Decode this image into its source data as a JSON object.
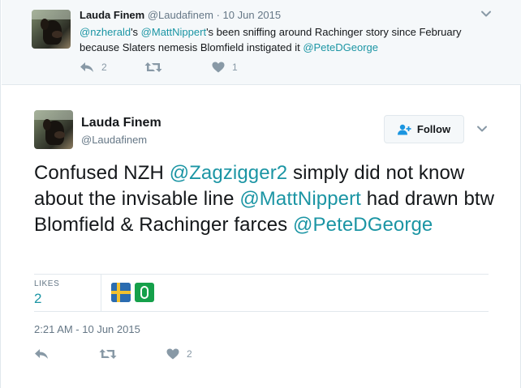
{
  "parent_tweet": {
    "author_name": "Lauda Finem",
    "author_handle": "@Laudafinem",
    "separator": "·",
    "date": "10 Jun 2015",
    "text_parts": [
      {
        "text": "@nzherald",
        "kind": "mention"
      },
      {
        "text": "'s ",
        "kind": "plain"
      },
      {
        "text": "@MattNippert",
        "kind": "mention"
      },
      {
        "text": "'s been sniffing around Rachinger story since February because Slaters nemesis Blomfield instigated it ",
        "kind": "plain"
      },
      {
        "text": "@PeteDGeorge",
        "kind": "mention"
      }
    ],
    "actions": {
      "reply_count": "2",
      "retweet_count": "",
      "like_count": "1"
    },
    "icons": {
      "avatar": "profile-photo-dog",
      "reply": "reply-icon",
      "retweet": "retweet-icon",
      "like": "heart-icon",
      "caret": "chevron-down-icon"
    }
  },
  "main_tweet": {
    "author_name": "Lauda Finem",
    "author_handle": "@Laudafinem",
    "follow_label": "Follow",
    "text_parts": [
      {
        "text": "Confused NZH ",
        "kind": "plain"
      },
      {
        "text": "@Zagzigger2",
        "kind": "mention"
      },
      {
        "text": " simply did not know about the invisable line ",
        "kind": "plain"
      },
      {
        "text": "@MattNippert",
        "kind": "mention"
      },
      {
        "text": " had drawn btw Blomfield & Rachinger farces ",
        "kind": "plain"
      },
      {
        "text": "@PeteDGeorge",
        "kind": "mention"
      }
    ],
    "stats": {
      "likes_label": "LIKES",
      "likes_count": "2"
    },
    "timestamp": "2:21 AM - 10 Jun 2015",
    "actions": {
      "reply_count": "",
      "retweet_count": "",
      "like_count": "2"
    }
  },
  "colors": {
    "mention": "#1b95a4",
    "secondary_text": "#657786",
    "icon_gray": "#8899a6",
    "parent_background": "#f5f8fa",
    "border": "#e1e8ed"
  }
}
